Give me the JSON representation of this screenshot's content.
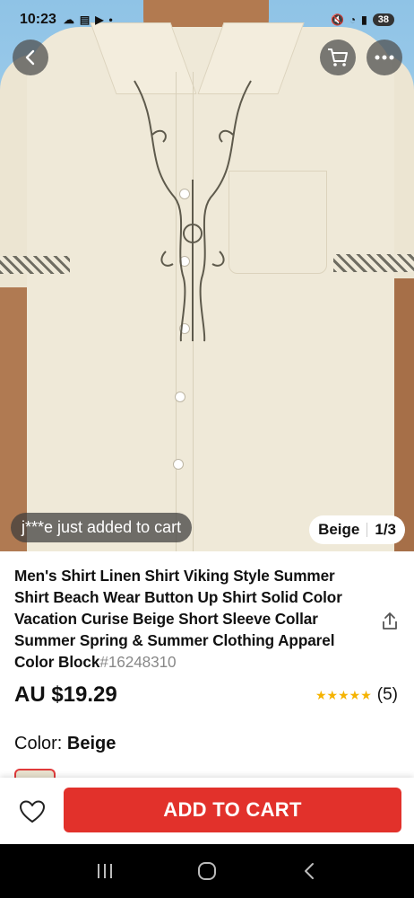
{
  "status_bar": {
    "time": "10:23",
    "battery": "38"
  },
  "hero": {
    "toast": "j***e just added to cart",
    "color_label": "Beige",
    "image_counter": "1/3"
  },
  "product": {
    "title": "Men's Shirt Linen Shirt Viking Style Summer Shirt Beach Wear Button Up Shirt Solid Color Vacation Curise Beige Short Sleeve Collar Summer Spring & Summer Clothing Apparel Color Block",
    "sku": "#16248310",
    "price": "AU $19.29",
    "rating_stars": 5,
    "rating_count": "(5)",
    "color_prefix": "Color:",
    "color_value": "Beige"
  },
  "actions": {
    "add_to_cart": "ADD TO CART"
  },
  "colors": {
    "accent": "#e2312b",
    "star": "#f5b301"
  }
}
